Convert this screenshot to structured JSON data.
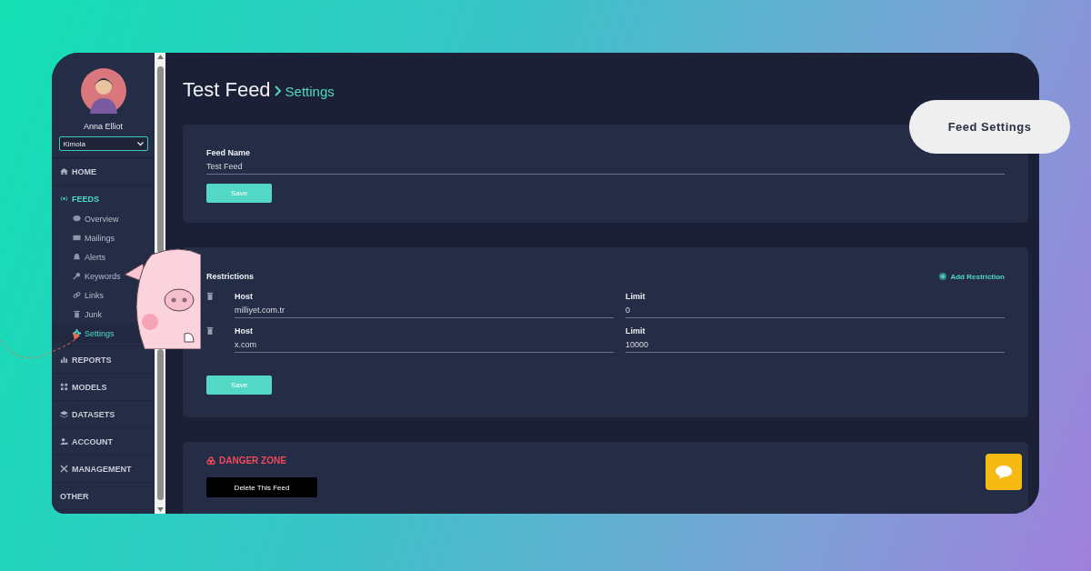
{
  "sidebar": {
    "user_name": "Anna Elliot",
    "workspace": "Kimola",
    "items": [
      {
        "label": "HOME",
        "selected": false
      },
      {
        "label": "FEEDS",
        "selected": true,
        "children": [
          {
            "label": "Overview",
            "selected": false
          },
          {
            "label": "Mailings",
            "selected": false
          },
          {
            "label": "Alerts",
            "selected": false
          },
          {
            "label": "Keywords",
            "selected": false
          },
          {
            "label": "Links",
            "selected": false
          },
          {
            "label": "Junk",
            "selected": false
          },
          {
            "label": "Settings",
            "selected": true
          }
        ]
      },
      {
        "label": "REPORTS",
        "selected": false
      },
      {
        "label": "MODELS",
        "selected": false
      },
      {
        "label": "DATASETS",
        "selected": false
      },
      {
        "label": "ACCOUNT",
        "selected": false
      },
      {
        "label": "MANAGEMENT",
        "selected": false
      },
      {
        "label": "OTHER",
        "selected": false
      }
    ]
  },
  "page": {
    "title": "Test Feed",
    "breadcrumb": "Settings"
  },
  "feed_name": {
    "label": "Feed Name",
    "value": "Test Feed",
    "button": "Save"
  },
  "restrictions": {
    "title": "Restrictions",
    "add_link": "Add Restriction",
    "rows": [
      {
        "host_label": "Host",
        "host": "milliyet.com.tr",
        "limit_label": "Limit",
        "limit": "0"
      },
      {
        "host_label": "Host",
        "host": "x.com",
        "limit_label": "Limit",
        "limit": "10000"
      }
    ],
    "button": "Save"
  },
  "danger_zone": {
    "title": "DANGER ZONE",
    "button": "Delete This Feed"
  },
  "callout": "Feed Settings"
}
